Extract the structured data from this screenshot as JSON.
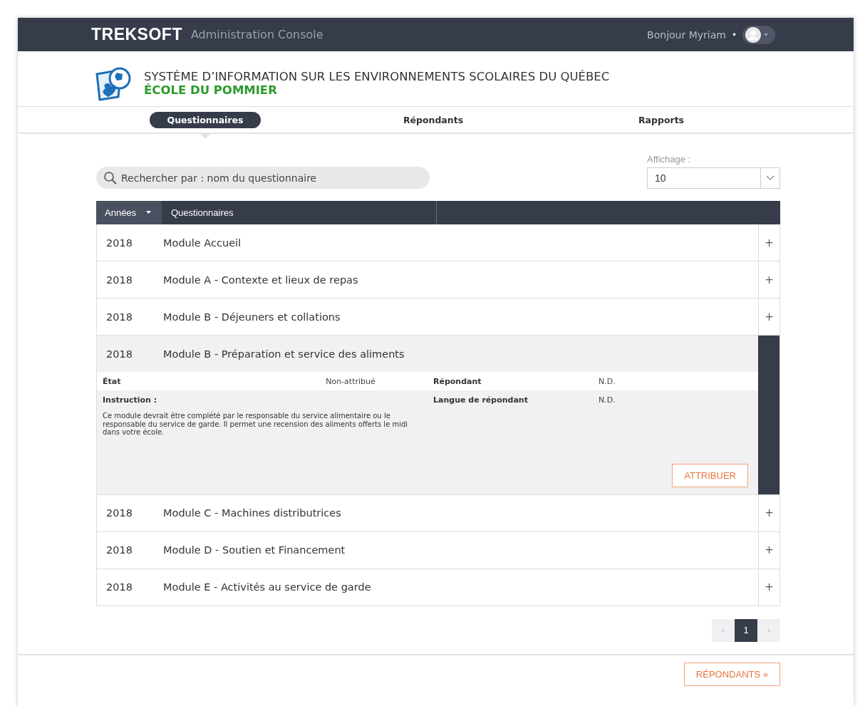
{
  "header": {
    "brand": "TREKSOFT",
    "subtitle": "Administration Console",
    "greeting": "Bonjour Myriam",
    "separator": "•"
  },
  "organization": {
    "title": "SYSTÈME D’INFORMATION SUR LES ENVIRONNEMENTS SCOLAIRES DU QUÉBEC",
    "school": "ÉCOLE DU POMMIER"
  },
  "tabs": [
    {
      "label": "Questionnaires",
      "selected": true
    },
    {
      "label": "Répondants",
      "selected": false
    },
    {
      "label": "Rapports",
      "selected": false
    }
  ],
  "search": {
    "placeholder": "Rechercher par : nom du questionnaire"
  },
  "display": {
    "label": "Affichage :",
    "value": "10"
  },
  "table": {
    "columns": [
      "Années",
      "Questionnaires"
    ],
    "rows": [
      {
        "year": "2018",
        "name": "Module Accueil",
        "expanded": false,
        "toggle": "+"
      },
      {
        "year": "2018",
        "name": "Module A - Contexte et lieux de repas",
        "expanded": false,
        "toggle": "+"
      },
      {
        "year": "2018",
        "name": "Module B - Déjeuners et collations",
        "expanded": false,
        "toggle": "+"
      },
      {
        "year": "2018",
        "name": "Module B - Préparation et service des aliments",
        "expanded": true,
        "details": {
          "state_label": "État",
          "state": "Non-attribué",
          "respondent_label": "Répondant",
          "respondent": "N.D.",
          "instruction_label": "Instruction :",
          "language_label": "Langue de répondant",
          "language": "N.D.",
          "instruction": "Ce module devrait être complété par le responsable du service alimentaire ou le responsable du service de garde. Il permet une recension des aliments offerts le midi dans votre école.",
          "button": "ATTRIBUER"
        }
      },
      {
        "year": "2018",
        "name": "Module C - Machines distributrices",
        "expanded": false,
        "toggle": "+"
      },
      {
        "year": "2018",
        "name": "Module D - Soutien et Financement",
        "expanded": false,
        "toggle": "+"
      },
      {
        "year": "2018",
        "name": "Module E - Activités au service de garde",
        "expanded": false,
        "toggle": "+"
      }
    ]
  },
  "pagination": {
    "prev": "‹",
    "pages": [
      {
        "label": "1",
        "selected": true
      }
    ],
    "next": "›"
  },
  "footer": {
    "button": "RÉPONDANTS »"
  }
}
